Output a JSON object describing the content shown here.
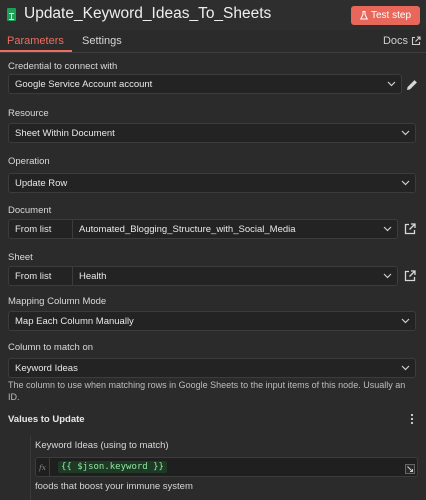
{
  "header": {
    "title": "Update_Keyword_Ideas_To_Sheets",
    "test_step_label": "Test step",
    "accent": "#e7675a"
  },
  "tabs": {
    "parameters": "Parameters",
    "settings": "Settings",
    "docs": "Docs"
  },
  "fields": {
    "credential": {
      "label": "Credential to connect with",
      "value": "Google Service Account account"
    },
    "resource": {
      "label": "Resource",
      "value": "Sheet Within Document"
    },
    "operation": {
      "label": "Operation",
      "value": "Update Row"
    },
    "document": {
      "label": "Document",
      "mode": "From list",
      "value": "Automated_Blogging_Structure_with_Social_Media"
    },
    "sheet": {
      "label": "Sheet",
      "mode": "From list",
      "value": "Health"
    },
    "mapping": {
      "label": "Mapping Column Mode",
      "value": "Map Each Column Manually"
    },
    "match_column": {
      "label": "Column to match on",
      "value": "Keyword Ideas",
      "hint": "The column to use when matching rows in Google Sheets to the input items of this node. Usually an ID."
    }
  },
  "values_section": {
    "title": "Values to Update",
    "item_label": "Keyword Ideas (using to match)",
    "fx": "fx",
    "expression": "{{ $json.keyword }}",
    "result": "foods that boost your immune system"
  },
  "icons": [
    "sheets-icon",
    "flask-icon",
    "external-link-icon",
    "pencil-icon",
    "chevron-down-icon",
    "kebab-icon",
    "expand-icon"
  ]
}
